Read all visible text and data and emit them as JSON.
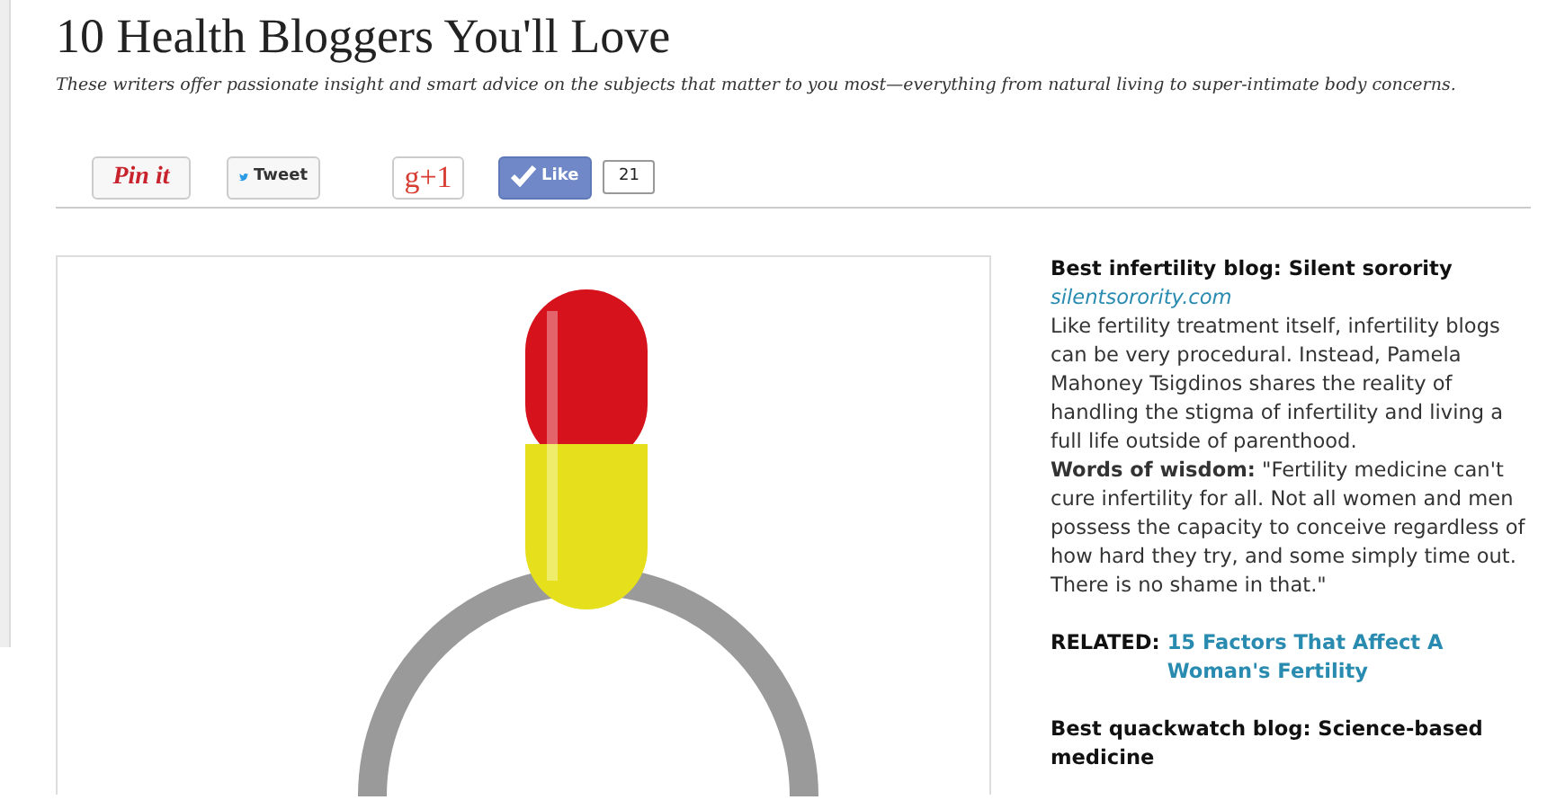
{
  "article": {
    "title": "10 Health Bloggers You'll Love",
    "dek": "These writers offer passionate insight and smart advice on the subjects that matter to you most—everything from natural living to super-intimate body concerns."
  },
  "share_buttons": [
    {
      "kind": "pinterest",
      "label": "Pin it"
    },
    {
      "kind": "twitter",
      "label": "Tweet"
    },
    {
      "kind": "gplus",
      "label": "g+1"
    },
    {
      "kind": "like",
      "label": "Like",
      "count": "21"
    }
  ],
  "sidebar": [
    {
      "kind": "entry",
      "heading": "Best infertility blog: Silent sorority",
      "link": "silentsorority.com",
      "body": "Like fertility treatment itself, infertility blogs can be very procedural. Instead, Pamela Mahoney Tsigdinos shares the reality of handling the stigma of infertility and living a full life outside of parenthood.",
      "quote": "**Words of wisdom:** \"Fertility medicine can't cure infertility for all. Not all women and men possess the capacity to conceive regardless of how hard they try, and some simply time out. There is no shame in that.\""
    },
    {
      "kind": "related",
      "label": "RELATED:",
      "link": "15 Factors That Affect A Woman's Fertility"
    },
    {
      "kind": "entry",
      "heading": "Best quackwatch blog: Science-based medicine"
    }
  ]
}
